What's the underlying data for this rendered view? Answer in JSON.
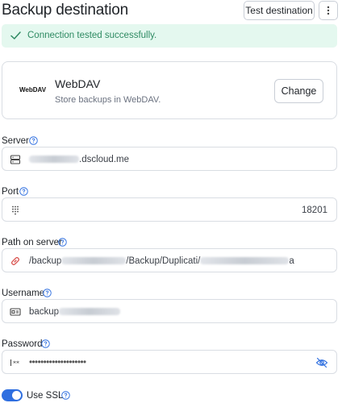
{
  "header": {
    "title": "Backup destination",
    "test_button": "Test destination"
  },
  "alert": {
    "message": "Connection tested successfully."
  },
  "provider": {
    "logo_text": "WebDAV",
    "name": "WebDAV",
    "description": "Store backups in WebDAV.",
    "change_label": "Change"
  },
  "fields": {
    "server": {
      "label": "Server",
      "value_suffix": ".dscloud.me"
    },
    "port": {
      "label": "Port",
      "value": "18201"
    },
    "path": {
      "label": "Path on server",
      "value_prefix": "/backup",
      "value_mid": "/Backup/Duplicati/",
      "value_suffix": "a"
    },
    "username": {
      "label": "Username",
      "value_prefix": "backup"
    },
    "password": {
      "label": "Password",
      "value": "••••••••••••••••••••"
    }
  },
  "ssl": {
    "label": "Use SSL",
    "enabled": true
  },
  "colors": {
    "accent": "#2f6fe0",
    "success_bg": "#e4f8ef",
    "success_text": "#2e8a62",
    "link_icon": "#d9534f"
  }
}
